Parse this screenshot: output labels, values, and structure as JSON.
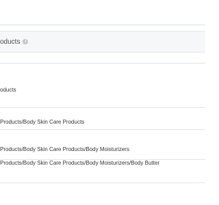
{
  "panel": {
    "title": "oducts",
    "info_icon": "i"
  },
  "rows": [
    {
      "text": ""
    },
    {
      "text": "oducts"
    },
    {
      "text": "Products/Body Skin Care Products"
    },
    {
      "text": "Products/Body Skin Care Products/Body Moisturizers"
    },
    {
      "text": "Products/Body Skin Care Products/Body Moisturizers/Body Butter"
    }
  ]
}
